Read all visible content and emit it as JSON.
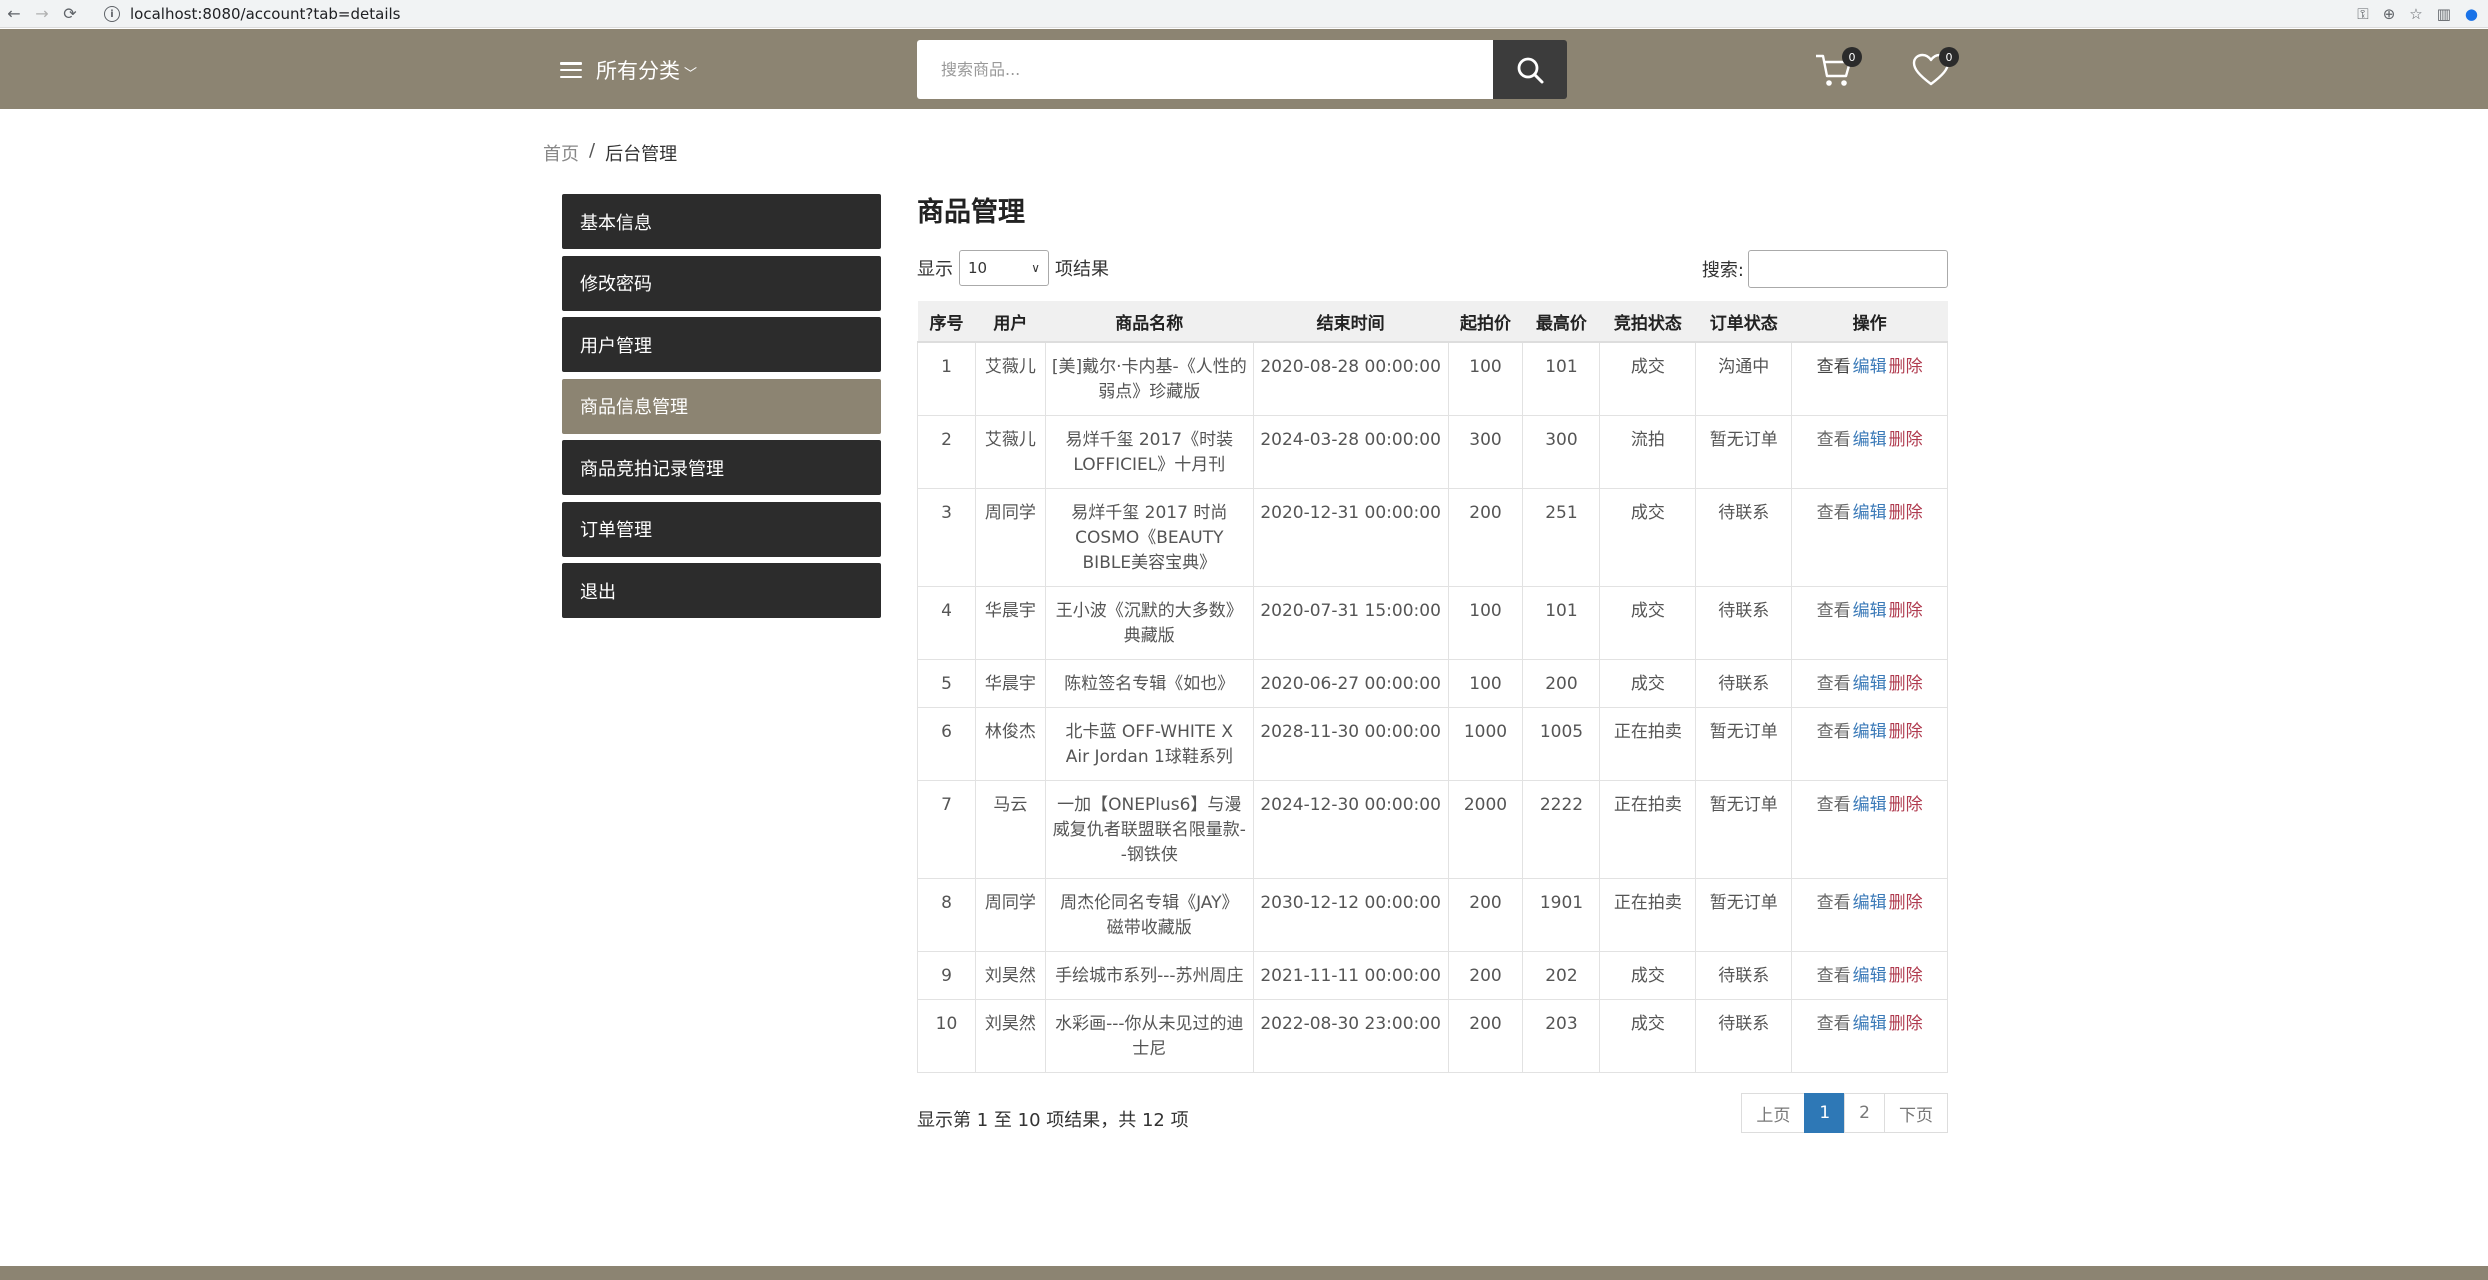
{
  "browser": {
    "url": "localhost:8080/account?tab=details"
  },
  "header": {
    "category_label": "所有分类",
    "search_placeholder": "搜索商品...",
    "cart_count": "0",
    "wishlist_count": "0"
  },
  "breadcrumb": {
    "home": "首页",
    "separator": "/",
    "current": "后台管理"
  },
  "sidebar": {
    "items": [
      {
        "label": "基本信息"
      },
      {
        "label": "修改密码"
      },
      {
        "label": "用户管理"
      },
      {
        "label": "商品信息管理"
      },
      {
        "label": "商品竞拍记录管理"
      },
      {
        "label": "订单管理"
      },
      {
        "label": "退出"
      }
    ],
    "active_index": 3
  },
  "main": {
    "title": "商品管理",
    "show_label": "显示",
    "page_size": "10",
    "entries_label": "项结果",
    "search_label": "搜索:",
    "columns": [
      "序号",
      "用户",
      "商品名称",
      "结束时间",
      "起拍价",
      "最高价",
      "竞拍状态",
      "订单状态",
      "操作"
    ],
    "actions": {
      "view": "查看",
      "edit": "编辑",
      "delete": "删除"
    },
    "rows": [
      {
        "no": "1",
        "user": "艾薇儿",
        "name": "[美]戴尔·卡内基-《人性的弱点》珍藏版",
        "end": "2020-08-28 00:00:00",
        "start": "100",
        "max": "101",
        "bid_status": "成交",
        "order_status": "沟通中"
      },
      {
        "no": "2",
        "user": "艾薇儿",
        "name": "易烊千玺 2017《时装LOFFICIEL》十月刊",
        "end": "2024-03-28 00:00:00",
        "start": "300",
        "max": "300",
        "bid_status": "流拍",
        "order_status": "暂无订单"
      },
      {
        "no": "3",
        "user": "周同学",
        "name": "易烊千玺 2017 时尚COSMO《BEAUTY BIBLE美容宝典》",
        "end": "2020-12-31 00:00:00",
        "start": "200",
        "max": "251",
        "bid_status": "成交",
        "order_status": "待联系"
      },
      {
        "no": "4",
        "user": "华晨宇",
        "name": "王小波《沉默的大多数》典藏版",
        "end": "2020-07-31 15:00:00",
        "start": "100",
        "max": "101",
        "bid_status": "成交",
        "order_status": "待联系"
      },
      {
        "no": "5",
        "user": "华晨宇",
        "name": "陈粒签名专辑《如也》",
        "end": "2020-06-27 00:00:00",
        "start": "100",
        "max": "200",
        "bid_status": "成交",
        "order_status": "待联系"
      },
      {
        "no": "6",
        "user": "林俊杰",
        "name": "北卡蓝 OFF-WHITE X Air Jordan 1球鞋系列",
        "end": "2028-11-30 00:00:00",
        "start": "1000",
        "max": "1005",
        "bid_status": "正在拍卖",
        "order_status": "暂无订单"
      },
      {
        "no": "7",
        "user": "马云",
        "name": "一加【ONEPlus6】与漫威复仇者联盟联名限量款--钢铁侠",
        "end": "2024-12-30 00:00:00",
        "start": "2000",
        "max": "2222",
        "bid_status": "正在拍卖",
        "order_status": "暂无订单"
      },
      {
        "no": "8",
        "user": "周同学",
        "name": "周杰伦同名专辑《JAY》磁带收藏版",
        "end": "2030-12-12 00:00:00",
        "start": "200",
        "max": "1901",
        "bid_status": "正在拍卖",
        "order_status": "暂无订单"
      },
      {
        "no": "9",
        "user": "刘昊然",
        "name": "手绘城市系列---苏州周庄",
        "end": "2021-11-11 00:00:00",
        "start": "200",
        "max": "202",
        "bid_status": "成交",
        "order_status": "待联系"
      },
      {
        "no": "10",
        "user": "刘昊然",
        "name": "水彩画---你从未见过的迪士尼",
        "end": "2022-08-30 23:00:00",
        "start": "200",
        "max": "203",
        "bid_status": "成交",
        "order_status": "待联系"
      }
    ],
    "info": "显示第 1 至 10 项结果，共 12 项",
    "pagination": {
      "prev": "上页",
      "pages": [
        "1",
        "2"
      ],
      "next": "下页",
      "current": "1"
    }
  },
  "colors": {
    "brand": "#8c8472",
    "dark": "#2c2c2c",
    "pager_active": "#2e78b6"
  }
}
